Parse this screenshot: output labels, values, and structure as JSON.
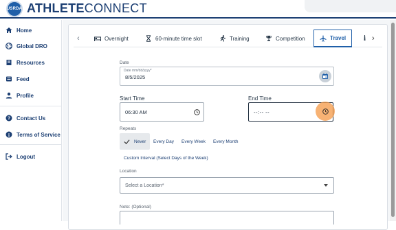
{
  "header": {
    "logo_text": "USRDA",
    "brand_bold": "ATHLETE",
    "brand_light": "CONNECT"
  },
  "sidebar": {
    "items": [
      {
        "label": "Home",
        "icon": "home-icon"
      },
      {
        "label": "Global DRO",
        "icon": "globe-icon"
      },
      {
        "label": "Resources",
        "icon": "book-icon"
      },
      {
        "label": "Feed",
        "icon": "feed-icon"
      },
      {
        "label": "Profile",
        "icon": "user-icon"
      },
      {
        "label": "Contact Us",
        "icon": "help-icon"
      },
      {
        "label": "Terms of Service",
        "icon": "info-icon"
      },
      {
        "label": "Logout",
        "icon": "logout-icon"
      }
    ]
  },
  "tabs": [
    {
      "label": "Overnight",
      "icon": "bed-icon"
    },
    {
      "label": "60-minute time slot",
      "icon": "hourglass-icon"
    },
    {
      "label": "Training",
      "icon": "running-icon"
    },
    {
      "label": "Competition",
      "icon": "trophy-icon"
    },
    {
      "label": "Travel",
      "icon": "plane-icon",
      "active": true
    }
  ],
  "form": {
    "date_section_label": "Date",
    "date_floating_label": "Date mm/dd/yyyy*",
    "date_value": "8/5/2025",
    "start_time_label": "Start Time",
    "start_time_value": "06:30 AM",
    "end_time_label": "End Time",
    "end_time_value": "--:-- --",
    "repeats_label": "Repeats",
    "repeat_options": [
      "Never",
      "Every Day",
      "Every Week",
      "Every Month",
      "Custom Interval (Select Days of the Week)"
    ],
    "repeat_selected": "Never",
    "location_label": "Location",
    "location_placeholder": "Select a Location*",
    "note_label": "Note: (Optional)"
  },
  "colors": {
    "brand": "#1c3f73",
    "accent": "#1f5fa8",
    "highlight": "#f49846"
  }
}
